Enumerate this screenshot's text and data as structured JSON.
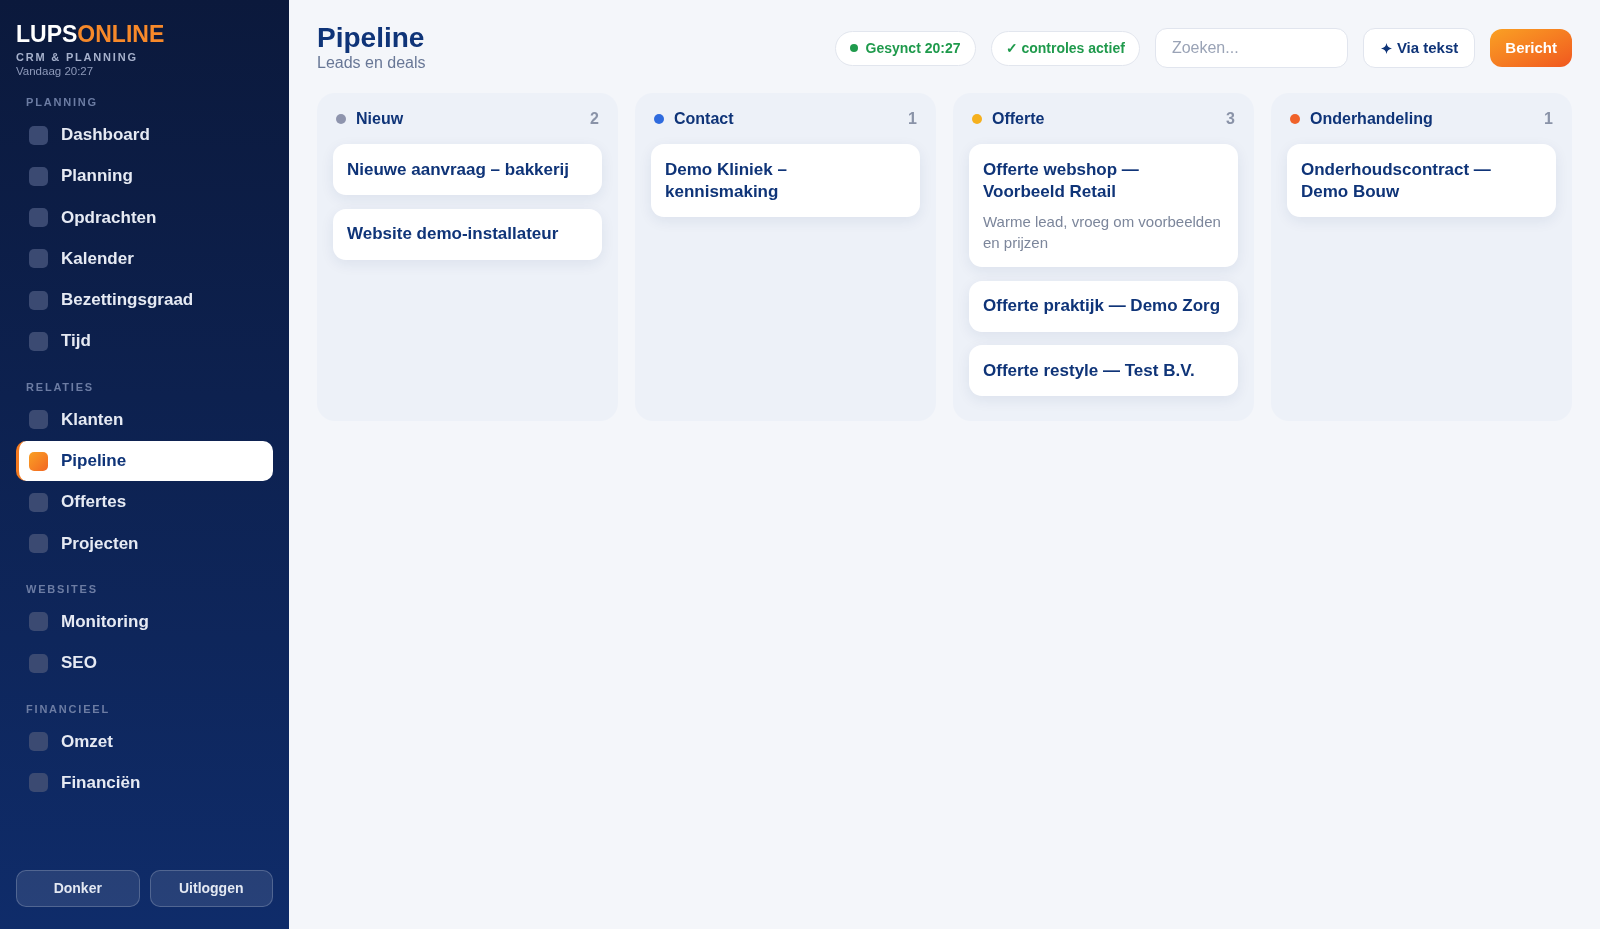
{
  "sidebar": {
    "logo": {
      "primary": "LUPS",
      "accent": "ONLINE"
    },
    "tagline": "CRM & PLANNING",
    "timestamp": "Vandaag 20:27",
    "sections": [
      {
        "title": "PLANNING",
        "items": [
          {
            "label": "Dashboard",
            "selected": false
          },
          {
            "label": "Planning",
            "selected": false
          },
          {
            "label": "Opdrachten",
            "selected": false
          },
          {
            "label": "Kalender",
            "selected": false
          },
          {
            "label": "Bezettingsgraad",
            "selected": false
          },
          {
            "label": "Tijd",
            "selected": false
          }
        ]
      },
      {
        "title": "RELATIES",
        "items": [
          {
            "label": "Klanten",
            "selected": false
          },
          {
            "label": "Pipeline",
            "selected": true
          },
          {
            "label": "Offertes",
            "selected": false
          },
          {
            "label": "Projecten",
            "selected": false
          }
        ]
      },
      {
        "title": "WEBSITES",
        "items": [
          {
            "label": "Monitoring",
            "selected": false
          },
          {
            "label": "SEO",
            "selected": false
          }
        ]
      },
      {
        "title": "FINANCIEEL",
        "items": [
          {
            "label": "Omzet",
            "selected": false
          },
          {
            "label": "Financiën",
            "selected": false
          }
        ]
      }
    ],
    "footer_buttons": [
      "Donker",
      "Uitloggen"
    ]
  },
  "header": {
    "title": "Pipeline",
    "subtitle": "Leads en deals",
    "status_pills": [
      {
        "label": "Gesynct 20:27",
        "kind": "dot"
      },
      {
        "label": "✓ controles actief",
        "kind": "plain"
      }
    ],
    "search": {
      "placeholder": "Zoeken..."
    },
    "buttons": [
      {
        "label": "Via tekst",
        "kind": "secondary"
      },
      {
        "label": "Bericht",
        "kind": "primary"
      }
    ]
  },
  "board": {
    "columns": [
      {
        "title": "Nieuw",
        "count": "2",
        "color": "#8e94ad",
        "cards": [
          {
            "title": "Nieuwe aanvraag – bakkerij"
          },
          {
            "title": "Website demo-installateur"
          }
        ]
      },
      {
        "title": "Contact",
        "count": "1",
        "color": "#2f6bde",
        "cards": [
          {
            "title": "Demo Kliniek – kennismaking"
          }
        ]
      },
      {
        "title": "Offerte",
        "count": "3",
        "color": "#f5b01e",
        "cards": [
          {
            "title": "Offerte webshop — Voorbeeld Retail",
            "description": "Warme lead, vroeg om voorbeelden en prijzen"
          },
          {
            "title": "Offerte praktijk — Demo Zorg"
          },
          {
            "title": "Offerte restyle — Test B.V."
          }
        ]
      },
      {
        "title": "Onderhandeling",
        "count": "1",
        "color": "#f0622a",
        "cards": [
          {
            "title": "Onderhoudscontract — Demo Bouw"
          }
        ]
      }
    ]
  }
}
